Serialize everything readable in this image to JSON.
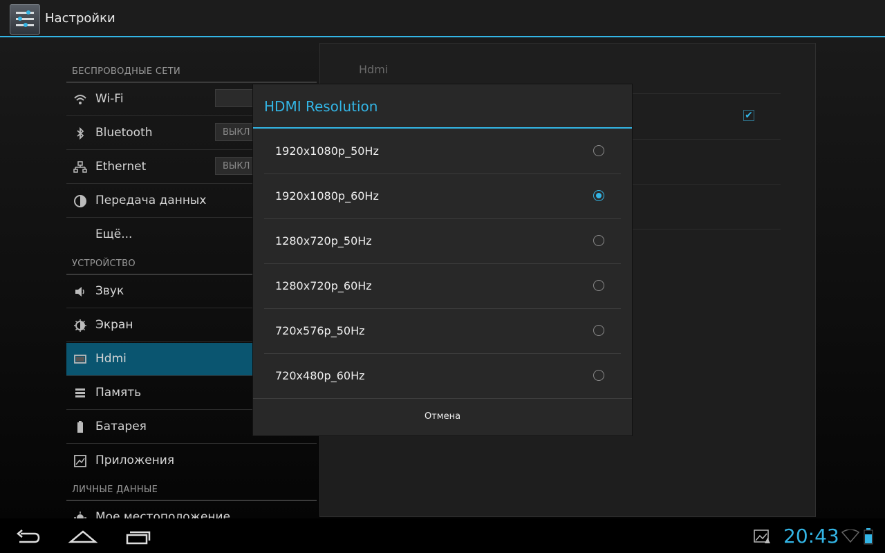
{
  "app": {
    "title": "Настройки",
    "icon": "settings-sliders-icon"
  },
  "sidebar": {
    "sections": [
      {
        "header": "БЕСПРОВОДНЫЕ СЕТИ"
      },
      {
        "header": "УСТРОЙСТВО"
      },
      {
        "header": "ЛИЧНЫЕ ДАННЫЕ"
      }
    ],
    "items": [
      {
        "label": "Wi-Fi",
        "icon": "wifi-icon",
        "toggle": ""
      },
      {
        "label": "Bluetooth",
        "icon": "bluetooth-icon",
        "toggle": "ВЫКЛ"
      },
      {
        "label": "Ethernet",
        "icon": "ethernet-icon",
        "toggle": "ВЫКЛ"
      },
      {
        "label": "Передача данных",
        "icon": "data-usage-icon"
      },
      {
        "label": "Ещё..."
      },
      {
        "label": "Звук",
        "icon": "speaker-icon"
      },
      {
        "label": "Экран",
        "icon": "brightness-icon"
      },
      {
        "label": "Hdmi",
        "icon": "hdmi-icon",
        "selected": true
      },
      {
        "label": "Память",
        "icon": "storage-icon"
      },
      {
        "label": "Батарея",
        "icon": "battery-icon"
      },
      {
        "label": "Приложения",
        "icon": "apps-icon"
      },
      {
        "label": "Мое местоположение",
        "icon": "location-icon"
      }
    ]
  },
  "detail": {
    "title": "Hdmi",
    "checkbox_checked": true
  },
  "dialog": {
    "title": "HDMI Resolution",
    "options": [
      {
        "label": "1920x1080p_50Hz",
        "checked": false
      },
      {
        "label": "1920x1080p_60Hz",
        "checked": true
      },
      {
        "label": "1280x720p_50Hz",
        "checked": false
      },
      {
        "label": "1280x720p_60Hz",
        "checked": false
      },
      {
        "label": "720x576p_50Hz",
        "checked": false
      },
      {
        "label": "720x480p_60Hz",
        "checked": false
      }
    ],
    "cancel_label": "Отмена"
  },
  "systembar": {
    "time": "20:43",
    "back_icon": "back-icon",
    "home_icon": "home-icon",
    "recents_icon": "recent-apps-icon"
  },
  "colors": {
    "accent": "#33b5e5",
    "selected_bg": "#0a5570"
  }
}
